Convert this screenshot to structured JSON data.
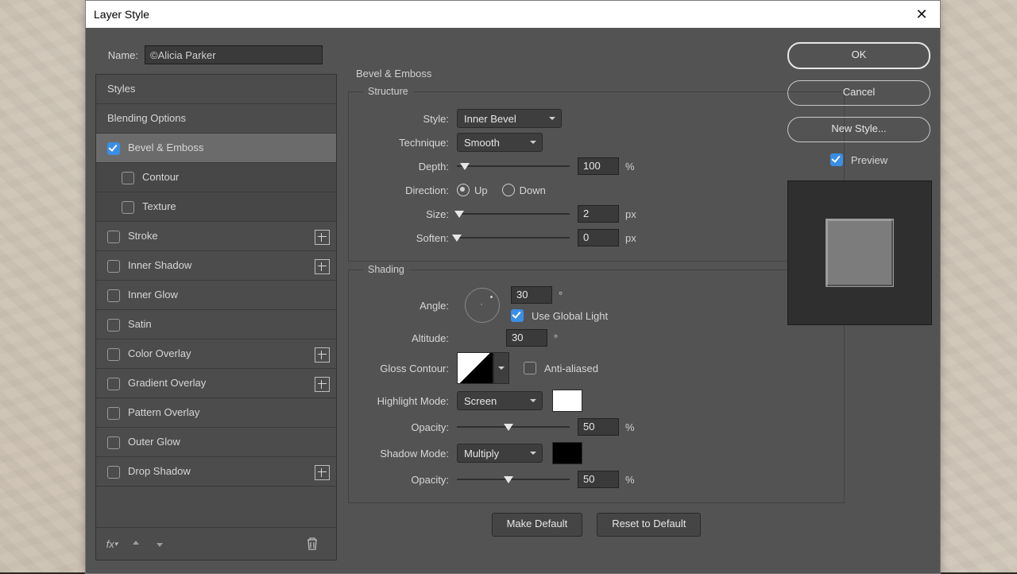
{
  "window": {
    "title": "Layer Style"
  },
  "name": {
    "label": "Name:",
    "value": "©Alicia Parker"
  },
  "styles_list": {
    "header": "Styles",
    "blending": "Blending Options",
    "items": [
      {
        "label": "Bevel & Emboss",
        "checked": true,
        "plus": false,
        "indent": 0,
        "selected": true
      },
      {
        "label": "Contour",
        "checked": false,
        "plus": false,
        "indent": 1
      },
      {
        "label": "Texture",
        "checked": false,
        "plus": false,
        "indent": 1
      },
      {
        "label": "Stroke",
        "checked": false,
        "plus": true,
        "indent": 0
      },
      {
        "label": "Inner Shadow",
        "checked": false,
        "plus": true,
        "indent": 0
      },
      {
        "label": "Inner Glow",
        "checked": false,
        "plus": false,
        "indent": 0
      },
      {
        "label": "Satin",
        "checked": false,
        "plus": false,
        "indent": 0
      },
      {
        "label": "Color Overlay",
        "checked": false,
        "plus": true,
        "indent": 0
      },
      {
        "label": "Gradient Overlay",
        "checked": false,
        "plus": true,
        "indent": 0
      },
      {
        "label": "Pattern Overlay",
        "checked": false,
        "plus": false,
        "indent": 0
      },
      {
        "label": "Outer Glow",
        "checked": false,
        "plus": false,
        "indent": 0
      },
      {
        "label": "Drop Shadow",
        "checked": false,
        "plus": true,
        "indent": 0
      }
    ]
  },
  "settings": {
    "title": "Bevel & Emboss",
    "structure": {
      "title": "Structure",
      "style": {
        "label": "Style:",
        "value": "Inner Bevel"
      },
      "technique": {
        "label": "Technique:",
        "value": "Smooth"
      },
      "depth": {
        "label": "Depth:",
        "value": "100",
        "unit": "%",
        "pos": 8
      },
      "direction": {
        "label": "Direction:",
        "up": "Up",
        "down": "Down",
        "selected": "up"
      },
      "size": {
        "label": "Size:",
        "value": "2",
        "unit": "px",
        "pos": 2
      },
      "soften": {
        "label": "Soften:",
        "value": "0",
        "unit": "px",
        "pos": 0
      }
    },
    "shading": {
      "title": "Shading",
      "angle": {
        "label": "Angle:",
        "value": "30",
        "unit": "°"
      },
      "global": {
        "label": "Use Global Light",
        "checked": true
      },
      "altitude": {
        "label": "Altitude:",
        "value": "30",
        "unit": "°"
      },
      "gloss": {
        "label": "Gloss Contour:"
      },
      "antialias": {
        "label": "Anti-aliased",
        "checked": false
      },
      "hmode": {
        "label": "Highlight Mode:",
        "value": "Screen",
        "color": "#ffffff"
      },
      "hopacity": {
        "label": "Opacity:",
        "value": "50",
        "unit": "%",
        "pos": 50
      },
      "smode": {
        "label": "Shadow Mode:",
        "value": "Multiply",
        "color": "#000000"
      },
      "sopacity": {
        "label": "Opacity:",
        "value": "50",
        "unit": "%",
        "pos": 50
      }
    },
    "make_default": "Make Default",
    "reset_default": "Reset to Default"
  },
  "right": {
    "ok": "OK",
    "cancel": "Cancel",
    "new_style": "New Style...",
    "preview": {
      "label": "Preview",
      "checked": true
    }
  }
}
